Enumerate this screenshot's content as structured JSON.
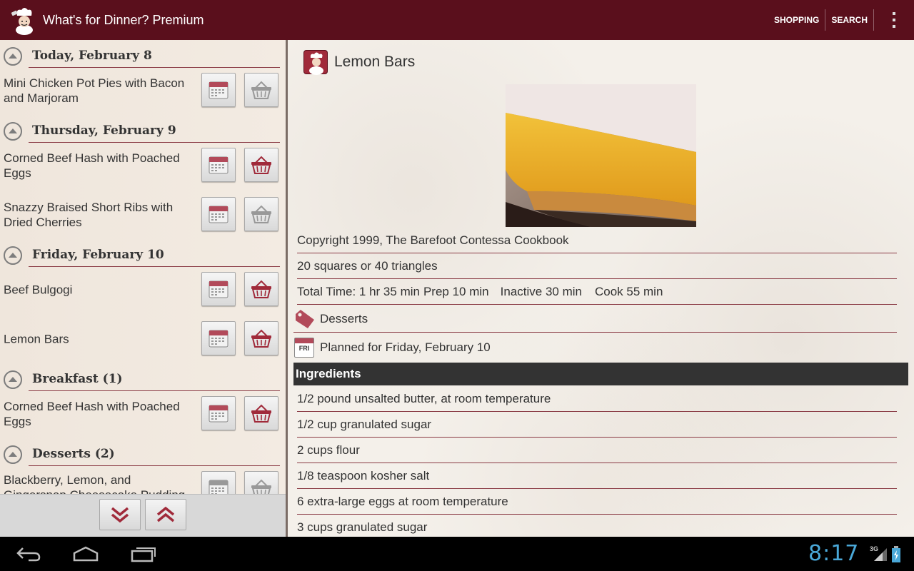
{
  "app": {
    "title": "What's for Dinner? Premium",
    "actions": [
      "SHOPPING",
      "SEARCH"
    ]
  },
  "left": {
    "groups": [
      {
        "title": "Today, February 8",
        "items": [
          {
            "name": "Mini Chicken Pot Pies with Bacon and Marjoram",
            "in_shopping": false
          }
        ]
      },
      {
        "title": "Thursday, February 9",
        "items": [
          {
            "name": "Corned Beef Hash with Poached Eggs",
            "in_shopping": true
          },
          {
            "name": "Snazzy Braised Short Ribs with Dried Cherries",
            "in_shopping": false
          }
        ]
      },
      {
        "title": "Friday, February 10",
        "items": [
          {
            "name": "Beef Bulgogi",
            "in_shopping": true
          },
          {
            "name": "Lemon Bars",
            "in_shopping": true
          }
        ]
      },
      {
        "title": "Breakfast (1)",
        "items": [
          {
            "name": "Corned Beef Hash with Poached Eggs",
            "in_shopping": true
          }
        ]
      },
      {
        "title": "Desserts (2)",
        "items": [
          {
            "name": "Blackberry, Lemon, and Gingersnap Cheesecake Pudding",
            "in_shopping": false
          }
        ]
      }
    ]
  },
  "recipe": {
    "title": "Lemon Bars",
    "source": "Copyright 1999, The Barefoot Contessa Cookbook",
    "yield": "20 squares or 40 triangles",
    "times": {
      "total": "Total Time: 1 hr 35 min",
      "prep": "Prep 10 min",
      "inactive": "Inactive 30 min",
      "cook": "Cook 55 min"
    },
    "category": "Desserts",
    "planned_day_abbr": "FRI",
    "planned": "Planned for Friday, February 10",
    "ingredients_header": "Ingredients",
    "ingredients": [
      "1/2 pound unsalted butter, at room temperature",
      "1/2 cup granulated sugar",
      "2 cups flour",
      "1/8 teaspoon kosher salt",
      "6 extra-large eggs at room temperature",
      "3 cups granulated sugar"
    ]
  },
  "status": {
    "clock": "8:17",
    "network": "3G"
  },
  "colors": {
    "actionbar": "#5a0f1c",
    "accent": "#a02a3a",
    "clock": "#4aa8d8"
  }
}
